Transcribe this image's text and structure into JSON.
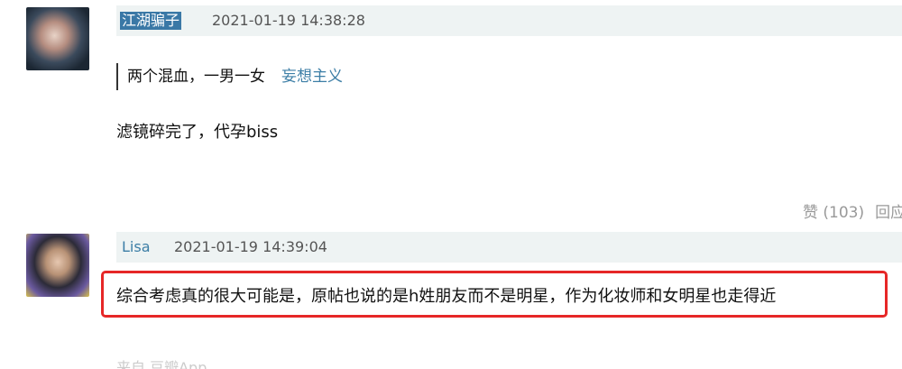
{
  "comments": [
    {
      "author": "江湖骗子",
      "timestamp": "2021-01-19 14:38:28",
      "quote": {
        "text": "两个混血，一男一女",
        "user": "妄想主义"
      },
      "body": "滤镜碎完了，代孕biss",
      "actions": {
        "like": "赞 (103)",
        "reply": "回应"
      }
    },
    {
      "author": "Lisa",
      "timestamp": "2021-01-19 14:39:04",
      "body": "综合考虑真的很大可能是，原帖也说的是h姓朋友而不是明星，作为化妆师和女明星也走得近"
    }
  ],
  "next_hint": "来自 豆瓣App"
}
